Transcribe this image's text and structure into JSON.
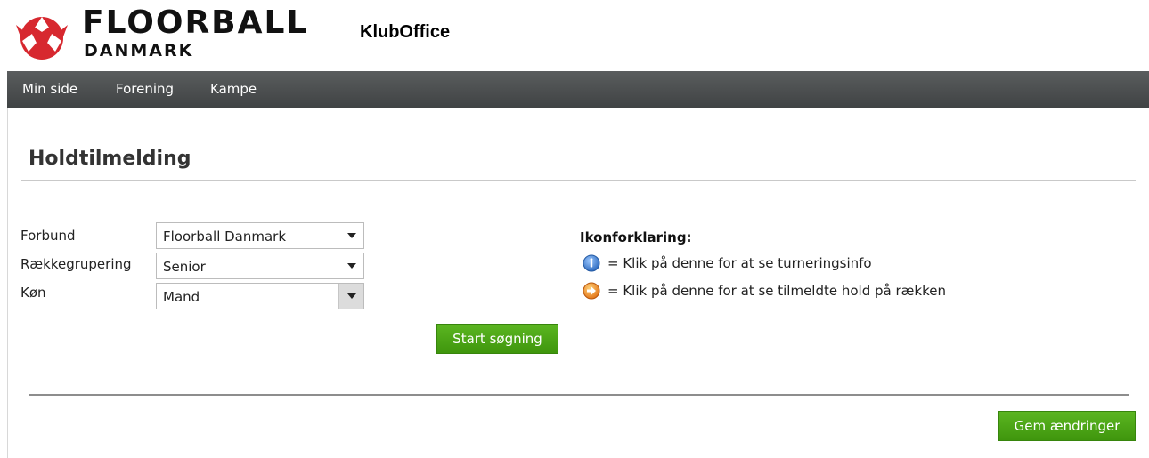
{
  "header": {
    "brand_main": "FLOORBALL",
    "brand_sub": "DANMARK",
    "app_name": "KlubOffice",
    "logo_icon": "floorball-logo-icon",
    "brand_color": "#d7282f"
  },
  "nav": {
    "items": [
      {
        "label": "Min side"
      },
      {
        "label": "Forening"
      },
      {
        "label": "Kampe"
      }
    ]
  },
  "page": {
    "title": "Holdtilmelding"
  },
  "form": {
    "forbund": {
      "label": "Forbund",
      "value": "Floorball Danmark"
    },
    "raekkegrupering": {
      "label": "Rækkegrupering",
      "value": "Senior"
    },
    "koen": {
      "label": "Køn",
      "value": "Mand"
    },
    "search_button": "Start søgning"
  },
  "legend": {
    "title": "Ikonforklaring:",
    "info_text": "= Klik på denne for at se turneringsinfo",
    "arrow_text": "= Klik på denne for at se tilmeldte hold på rækken",
    "info_icon": "info-icon",
    "arrow_icon": "arrow-right-circle-icon"
  },
  "footer": {
    "save_button": "Gem ændringer"
  },
  "colors": {
    "nav_bg": "#4a4d4e",
    "button_green": "#4ca617",
    "info_blue": "#3f7fd0",
    "arrow_orange": "#f29a1c"
  }
}
